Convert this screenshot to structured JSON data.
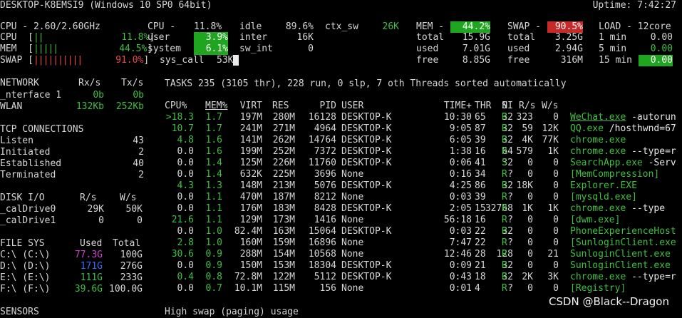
{
  "header": {
    "host": "DESKTOP-K8EMSI9 (Windows 10 SP0 64bit)",
    "uptime": "Uptime: 7:42:27"
  },
  "quicklook": {
    "cpu_label": "CPU - 2.60/2.60GHz",
    "rows": [
      {
        "label": "CPU",
        "value": "11.8%"
      },
      {
        "label": "MEM",
        "value": "44.5%"
      },
      {
        "label": "SWAP",
        "value": "91.0%"
      }
    ]
  },
  "cpu": {
    "title": "CPU -",
    "total": "11.8%",
    "user_label": "user",
    "user": "3.9%",
    "system_label": "system",
    "system": "6.1%",
    "syscall_label": "sys_call",
    "syscall": "53K",
    "idle_label": "idle",
    "idle": "89.6%",
    "inter_label": "inter",
    "inter": "16K",
    "swint_label": "sw_int",
    "swint": "0",
    "ctxsw_label": "ctx_sw",
    "ctxsw": "26K"
  },
  "mem": {
    "title": "MEM -",
    "percent": "44.2%",
    "total_label": "total",
    "total": "15.9G",
    "used_label": "used",
    "used": "7.01G",
    "free_label": "free",
    "free": "8.85G"
  },
  "swap": {
    "title": "SWAP -",
    "percent": "90.5%",
    "total_label": "total",
    "total": "3.25G",
    "used_label": "used",
    "used": "2.94G",
    "free_label": "free",
    "free": "316M"
  },
  "load": {
    "title": "LOAD - 12core",
    "rows": [
      {
        "label": "1 min",
        "value": "0.00"
      },
      {
        "label": "5 min",
        "value": "0.00"
      },
      {
        "label": "15 min",
        "value": "0.00"
      }
    ]
  },
  "network": {
    "title": "NETWORK",
    "rx": "Rx/s",
    "tx": "Tx/s",
    "rows": [
      {
        "name": "_nterface 1",
        "rx": "0b",
        "tx": "0b"
      },
      {
        "name": "WLAN",
        "rx": "132Kb",
        "tx": "252Kb"
      }
    ]
  },
  "tcp": {
    "title": "TCP CONNECTIONS",
    "rows": [
      {
        "label": "Listen",
        "value": "43"
      },
      {
        "label": "Initiated",
        "value": "2"
      },
      {
        "label": "Established",
        "value": "40"
      },
      {
        "label": "Terminated",
        "value": "2"
      }
    ]
  },
  "disk": {
    "title": "DISK I/O",
    "r": "R/s",
    "w": "W/s",
    "rows": [
      {
        "name": "_calDrive0",
        "r": "29K",
        "w": "50K"
      },
      {
        "name": "_calDrive1",
        "r": "0",
        "w": "0"
      }
    ]
  },
  "fs": {
    "title": "FILE SYS",
    "used": "Used",
    "total": "Total",
    "rows": [
      {
        "name": "C:\\ (C:\\)",
        "used": "77.3G",
        "total": "100G",
        "color": "#d23fd2"
      },
      {
        "name": "D:\\ (D:\\)",
        "used": "171G",
        "total": "276G",
        "color": "#3a6cff"
      },
      {
        "name": "E:\\ (E:\\)",
        "used": "111G",
        "total": "233G",
        "color": "#3fbf3f"
      },
      {
        "name": "F:\\ (F:\\)",
        "used": "39.6G",
        "total": "100.0G",
        "color": "#3fbf3f"
      }
    ]
  },
  "sensors": {
    "title": "SENSORS"
  },
  "alert": "High swap (paging) usage",
  "tasks": {
    "summary": "TASKS 235 (3105 thr), 228 run, 0 slp, 7 oth Threads sorted automatically",
    "headers": {
      "cpu": "CPU%",
      "mem": "MEM%",
      "virt": "VIRT",
      "res": "RES",
      "pid": "PID",
      "user": "USER",
      "time": "TIME+",
      "thr": "THR",
      "ni": "NI",
      "s": "S",
      "rs": "R/s",
      "ws": "W/s"
    },
    "rows": [
      {
        "cpu": ">18.3",
        "mem": "1.7",
        "virt": "197M",
        "res": "280M",
        "pid": "16128",
        "user": "DESKTOP-K",
        "time": "10:30",
        "thr": "65",
        "ni": "32",
        "s": "R",
        "rs": "323",
        "ws": "0",
        "cmd": "WeChat.exe",
        "args": "-autorun"
      },
      {
        "cpu": "10.7",
        "mem": "1.7",
        "virt": "241M",
        "res": "271M",
        "pid": "4964",
        "user": "DESKTOP-K",
        "time": "9:05",
        "thr": "87",
        "ni": "32",
        "s": "R",
        "rs": "59",
        "ws": "12K",
        "cmd": "QQ.exe",
        "args": "/hosthwnd=67"
      },
      {
        "cpu": "4.8",
        "mem": "1.6",
        "virt": "141M",
        "res": "262M",
        "pid": "14764",
        "user": "DESKTOP-K",
        "time": "6:05",
        "thr": "39",
        "ni": "32",
        "s": "R",
        "rs": "4K",
        "ws": "77K",
        "cmd": "chrome.exe",
        "args": ""
      },
      {
        "cpu": "0.0",
        "mem": "1.6",
        "virt": "199M",
        "res": "252M",
        "pid": "7372",
        "user": "DESKTOP-K",
        "time": "1:38",
        "thr": "16",
        "ni": "64",
        "s": "R",
        "rs": "579",
        "ws": "1K",
        "cmd": "chrome.exe",
        "args": "--type=r"
      },
      {
        "cpu": "0.0",
        "mem": "1.4",
        "virt": "125M",
        "res": "226M",
        "pid": "11760",
        "user": "DESKTOP-K",
        "time": "0:06",
        "thr": "41",
        "ni": "32",
        "s": "S",
        "rs": "0",
        "ws": "0",
        "cmd": "SearchApp.exe",
        "args": "-Serv"
      },
      {
        "cpu": "0.0",
        "mem": "1.4",
        "virt": "632K",
        "res": "225M",
        "pid": "3696",
        "user": "None",
        "time": "0:16",
        "thr": "34",
        "ni": "?",
        "s": "R",
        "rs": "0",
        "ws": "0",
        "cmd": "[MemCompression]",
        "args": ""
      },
      {
        "cpu": "4.3",
        "mem": "1.3",
        "virt": "148M",
        "res": "213M",
        "pid": "5076",
        "user": "DESKTOP-K",
        "time": "4:25",
        "thr": "86",
        "ni": "32",
        "s": "R",
        "rs": "18K",
        "ws": "0",
        "cmd": "Explorer.EXE",
        "args": ""
      },
      {
        "cpu": "0.0",
        "mem": "1.1",
        "virt": "470M",
        "res": "187M",
        "pid": "8212",
        "user": "None",
        "time": "0:03",
        "thr": "39",
        "ni": "?",
        "s": "R",
        "rs": "0",
        "ws": "0",
        "cmd": "[mysqld.exe]",
        "args": ""
      },
      {
        "cpu": "0.0",
        "mem": "1.1",
        "virt": "176M",
        "res": "183M",
        "pid": "8428",
        "user": "DESKTOP-K",
        "time": "2:05",
        "thr": "15",
        "ni": "32768",
        "s": "R",
        "rs": "1K",
        "ws": "1K",
        "cmd": "chrome.exe",
        "args": "--type"
      },
      {
        "cpu": "21.6",
        "mem": "1.1",
        "virt": "129M",
        "res": "173M",
        "pid": "1416",
        "user": "None",
        "time": "56:18",
        "thr": "16",
        "ni": "?",
        "s": "R",
        "rs": "0",
        "ws": "0",
        "cmd": "[dwm.exe]",
        "args": ""
      },
      {
        "cpu": "0.0",
        "mem": "1.0",
        "virt": "82.4M",
        "res": "163M",
        "pid": "15064",
        "user": "DESKTOP-K",
        "time": "0:03",
        "thr": "22",
        "ni": "32",
        "s": "R",
        "rs": "0",
        "ws": "0",
        "cmd": "PhoneExperienceHost",
        "args": ""
      },
      {
        "cpu": "2.8",
        "mem": "1.0",
        "virt": "160M",
        "res": "159M",
        "pid": "16896",
        "user": "None",
        "time": "7:47",
        "thr": "22",
        "ni": "?",
        "s": "R",
        "rs": "0",
        "ws": "0",
        "cmd": "[SunloginClient.exe",
        "args": ""
      },
      {
        "cpu": "30.6",
        "mem": "0.9",
        "virt": "288M",
        "res": "154M",
        "pid": "10568",
        "user": "None",
        "time": "12:46",
        "thr": "28",
        "ni": "128",
        "s": "R",
        "rs": "0",
        "ws": "21",
        "cmd": "SunloginClient.exe",
        "args": ""
      },
      {
        "cpu": "0.0",
        "mem": "0.9",
        "virt": "150M",
        "res": "153M",
        "pid": "18304",
        "user": "DESKTOP-K",
        "time": "0:09",
        "thr": "21",
        "ni": "32",
        "s": "R",
        "rs": "0",
        "ws": "0",
        "cmd": "SunloginClient.exe",
        "args": ""
      },
      {
        "cpu": "0.4",
        "mem": "0.8",
        "virt": "72.8M",
        "res": "122M",
        "pid": "5112",
        "user": "DESKTOP-K",
        "time": "0:43",
        "thr": "18",
        "ni": "32",
        "s": "R",
        "rs": "2K",
        "ws": "3K",
        "cmd": "chrome.exe",
        "args": "--type=r"
      },
      {
        "cpu": "0.0",
        "mem": "0.7",
        "virt": "10.1M",
        "res": "115M",
        "pid": "156",
        "user": "None",
        "time": "0:01",
        "thr": "4",
        "ni": "?",
        "s": "R",
        "rs": "0",
        "ws": "0",
        "cmd": "[Registry]",
        "args": ""
      }
    ]
  },
  "watermark": "CSDN @Black--Dragon"
}
